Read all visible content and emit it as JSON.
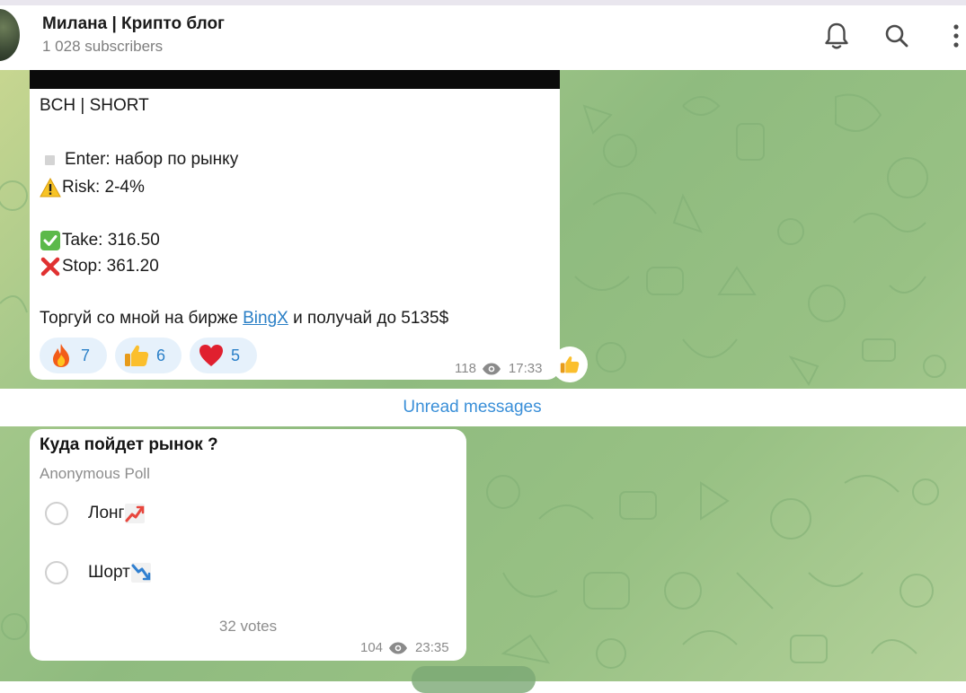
{
  "header": {
    "title": "Милана | Крипто блог",
    "subscribers": "1 028 subscribers"
  },
  "post": {
    "pair_line": "BCH | SHORT",
    "enter_line": "Enter: набор по рынку",
    "risk_line": "Risk: 2-4%",
    "take_line": "Take: 316.50",
    "stop_line": "Stop: 361.20",
    "cta_prefix": "Торгуй со мной на бирже ",
    "cta_link": "BingX",
    "cta_suffix": " и получай до 5135$",
    "reactions": [
      {
        "emoji": "fire",
        "count": "7"
      },
      {
        "emoji": "thumbs-up",
        "count": "6"
      },
      {
        "emoji": "heart",
        "count": "5"
      }
    ],
    "views": "118",
    "time": "17:33"
  },
  "unread_label": "Unread messages",
  "poll": {
    "question": "Куда пойдет рынок ?",
    "type": "Anonymous Poll",
    "options": [
      {
        "label": "Лонг",
        "icon": "chart-increasing"
      },
      {
        "label": "Шорт",
        "icon": "chart-decreasing"
      }
    ],
    "votes": "32 votes",
    "views": "104",
    "time": "23:35"
  },
  "colors": {
    "accent": "#3a8fd8",
    "link": "#2a7fc6",
    "reaction_bg": "#e6f1fb"
  }
}
